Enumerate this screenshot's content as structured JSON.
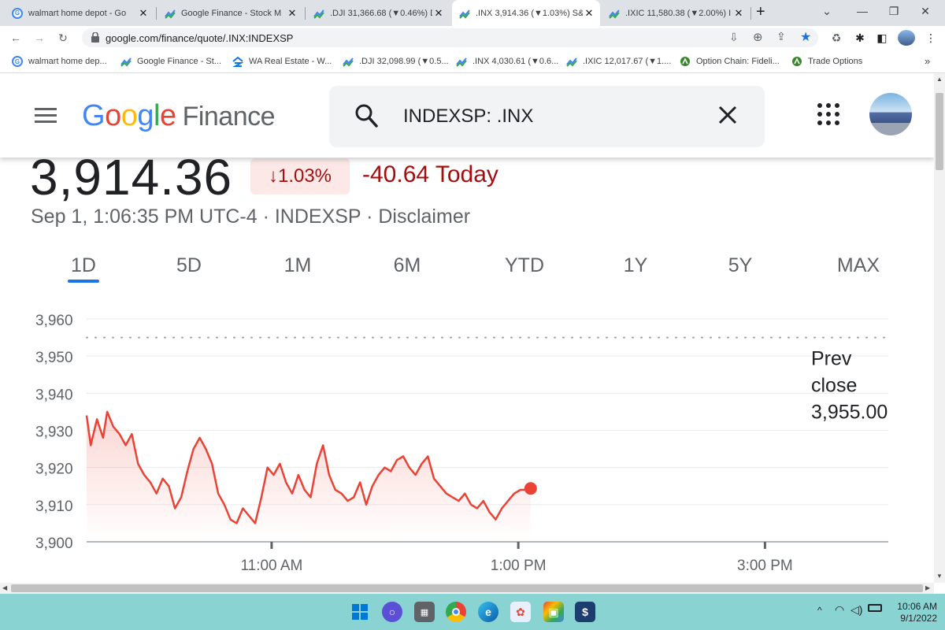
{
  "browser": {
    "tabs": [
      {
        "title": "walmart home depot - Go",
        "icon": "google-g-icon",
        "active": false
      },
      {
        "title": "Google Finance - Stock M",
        "icon": "google-finance-icon",
        "active": false
      },
      {
        "title": ".DJI 31,366.68 (▼0.46%) D",
        "icon": "google-finance-icon",
        "active": false
      },
      {
        "title": ".INX 3,914.36 (▼1.03%) S&",
        "icon": "google-finance-icon",
        "active": true
      },
      {
        "title": ".IXIC 11,580.38 (▼2.00%) I",
        "icon": "google-finance-icon",
        "active": false
      }
    ],
    "new_tab": "+",
    "url": "google.com/finance/quote/.INX:INDEXSP",
    "bookmarks": [
      {
        "label": "walmart home dep...",
        "icon": "google-g-icon"
      },
      {
        "label": "Google Finance - St...",
        "icon": "google-finance-icon"
      },
      {
        "label": "WA Real Estate - W...",
        "icon": "zillow-icon"
      },
      {
        "label": ".DJI 32,098.99 (▼0.5...",
        "icon": "google-finance-icon"
      },
      {
        "label": ".INX 4,030.61 (▼0.6...",
        "icon": "google-finance-icon"
      },
      {
        "label": ".IXIC 12,017.67 (▼1....",
        "icon": "google-finance-icon"
      },
      {
        "label": "Option Chain: Fideli...",
        "icon": "fidelity-icon"
      },
      {
        "label": "Trade Options",
        "icon": "fidelity-icon"
      }
    ],
    "bookmarks_more": "»"
  },
  "header": {
    "logo_google": "Google",
    "logo_finance": "Finance",
    "search_value": "INDEXSP: .INX"
  },
  "quote": {
    "price": "3,914.36",
    "change_percent": "↓1.03%",
    "change_today": "-40.64 Today",
    "meta": "Sep 1, 1:06:35 PM UTC-4 · INDEXSP · Disclaimer"
  },
  "ranges": [
    {
      "label": "1D",
      "active": true
    },
    {
      "label": "5D",
      "active": false
    },
    {
      "label": "1M",
      "active": false
    },
    {
      "label": "6M",
      "active": false
    },
    {
      "label": "YTD",
      "active": false
    },
    {
      "label": "1Y",
      "active": false
    },
    {
      "label": "5Y",
      "active": false
    },
    {
      "label": "MAX",
      "active": false
    }
  ],
  "colors": {
    "line": "#ea4335",
    "down": "#a50e0e",
    "accent": "#1a73e8"
  },
  "chart_data": {
    "type": "line",
    "ylim": [
      3900,
      3960
    ],
    "yticks": [
      "3,960",
      "3,950",
      "3,940",
      "3,930",
      "3,920",
      "3,910",
      "3,900"
    ],
    "ytick_values": [
      3960,
      3950,
      3940,
      3930,
      3920,
      3910,
      3900
    ],
    "xlim": [
      "09:30",
      "16:00"
    ],
    "xticks": [
      {
        "time": "11:00",
        "label": "11:00 AM"
      },
      {
        "time": "13:00",
        "label": "1:00 PM"
      },
      {
        "time": "15:00",
        "label": "3:00 PM"
      }
    ],
    "prev_close": 3955.0,
    "prev_close_label": [
      "Prev",
      "close",
      "3,955.00"
    ],
    "series": [
      {
        "x": [
          "09:30",
          "09:32",
          "09:35",
          "09:38",
          "09:40",
          "09:43",
          "09:46",
          "09:49",
          "09:52",
          "09:55",
          "09:58",
          "10:01",
          "10:04",
          "10:07",
          "10:10",
          "10:13",
          "10:16",
          "10:19",
          "10:22",
          "10:25",
          "10:28",
          "10:31",
          "10:34",
          "10:37",
          "10:40",
          "10:43",
          "10:46",
          "10:49",
          "10:52",
          "10:55",
          "10:58",
          "11:01",
          "11:04",
          "11:07",
          "11:10",
          "11:13",
          "11:16",
          "11:19",
          "11:22",
          "11:25",
          "11:28",
          "11:31",
          "11:34",
          "11:37",
          "11:40",
          "11:43",
          "11:46",
          "11:49",
          "11:52",
          "11:55",
          "11:58",
          "12:01",
          "12:04",
          "12:07",
          "12:10",
          "12:13",
          "12:16",
          "12:19",
          "12:22",
          "12:25",
          "12:28",
          "12:31",
          "12:34",
          "12:37",
          "12:40",
          "12:43",
          "12:46",
          "12:49",
          "12:52",
          "12:55",
          "12:58",
          "13:01",
          "13:04",
          "13:06"
        ],
        "y": [
          3934,
          3926,
          3933,
          3928,
          3935,
          3931,
          3929,
          3926,
          3929,
          3921,
          3918,
          3916,
          3913,
          3917,
          3915,
          3909,
          3912,
          3919,
          3925,
          3928,
          3925,
          3921,
          3913,
          3910,
          3906,
          3905,
          3909,
          3907,
          3905,
          3912,
          3920,
          3918,
          3921,
          3916,
          3913,
          3918,
          3914,
          3912,
          3921,
          3926,
          3918,
          3914,
          3913,
          3911,
          3912,
          3916,
          3910,
          3915,
          3918,
          3920,
          3919,
          3922,
          3923,
          3920,
          3918,
          3921,
          3923,
          3917,
          3915,
          3913,
          3912,
          3911,
          3913,
          3910,
          3909,
          3911,
          3908,
          3906,
          3909,
          3911,
          3913,
          3914,
          3914,
          3914.36
        ]
      }
    ]
  },
  "taskbar": {
    "time": "10:06 AM",
    "date": "9/1/2022"
  }
}
